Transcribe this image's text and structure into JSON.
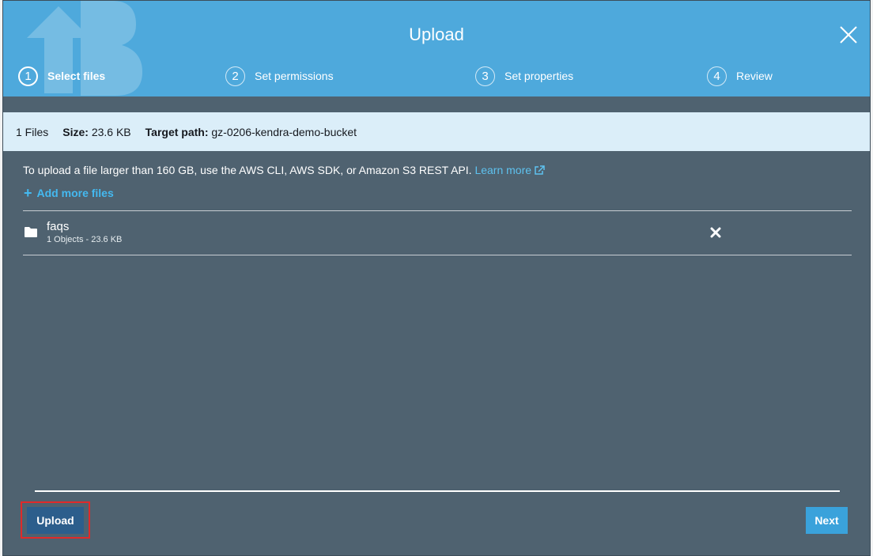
{
  "modal": {
    "title": "Upload"
  },
  "steps": [
    {
      "number": "1",
      "label": "Select files",
      "active": true
    },
    {
      "number": "2",
      "label": "Set permissions",
      "active": false
    },
    {
      "number": "3",
      "label": "Set properties",
      "active": false
    },
    {
      "number": "4",
      "label": "Review",
      "active": false
    }
  ],
  "summary": {
    "files_count": "1 Files",
    "size_label": "Size:",
    "size_value": "23.6 KB",
    "target_label": "Target path:",
    "target_value": "gz-0206-kendra-demo-bucket"
  },
  "info": {
    "text": "To upload a file larger than 160 GB, use the AWS CLI, AWS SDK, or Amazon S3 REST API.",
    "learn_more": "Learn more"
  },
  "add_more_files": "Add more files",
  "files": [
    {
      "name": "faqs",
      "meta": "1 Objects - 23.6 KB",
      "icon": "folder-icon"
    }
  ],
  "buttons": {
    "upload": "Upload",
    "next": "Next"
  },
  "colors": {
    "header": "#4ea9dc",
    "body": "#4f6270",
    "summary_bar": "#dbeef9",
    "link": "#5ec2ef",
    "upload_button": "#2c5e8c",
    "next_button": "#3aa2db",
    "highlight": "#e02a2a"
  }
}
